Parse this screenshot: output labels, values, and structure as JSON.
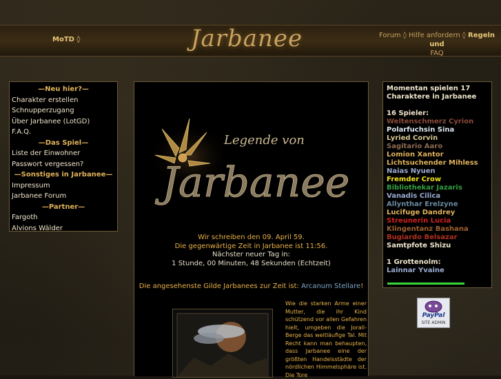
{
  "header": {
    "logo_text": "Jarbanee",
    "motd": "MoTD ◊",
    "topnav": {
      "forum": "Forum ◊",
      "hilfe": "Hilfe anfordern ◊",
      "regeln": "Regeln und",
      "faq": "FAQ"
    }
  },
  "leftnav": [
    {
      "type": "head",
      "label": "—Neu hier?—"
    },
    {
      "type": "link",
      "label": "Charakter erstellen"
    },
    {
      "type": "link",
      "label": "Schnupperzugang"
    },
    {
      "type": "link",
      "label": "Über Jarbanee (LotGD)"
    },
    {
      "type": "link",
      "label": "F.A.Q."
    },
    {
      "type": "head",
      "label": "—Das Spiel—"
    },
    {
      "type": "link",
      "label": "Liste der Einwohner"
    },
    {
      "type": "link",
      "label": "Passwort vergessen?"
    },
    {
      "type": "head",
      "label": "—Sonstiges in Jarbanee—"
    },
    {
      "type": "link",
      "label": "Impressum"
    },
    {
      "type": "link",
      "label": "Jarbanee Forum"
    },
    {
      "type": "head",
      "label": "—Partner—"
    },
    {
      "type": "link",
      "label": "Fargoth"
    },
    {
      "type": "link",
      "label": "Alvions Wälder"
    }
  ],
  "center": {
    "title_small": "Legende von",
    "title_big": "Jarbanee",
    "date_line": "Wir schreiben den 09. April 59.",
    "time_line": "Die gegenwärtige Zeit in Jarbanee ist 11:56.",
    "next_day": "Nächster neuer Tag in:",
    "countdown": "1 Stunde, 00 Minuten, 48 Sekunden (Echtzeit)",
    "guild_prefix": "Die angesehenste Gilde Jarbanees zur Zeit ist: ",
    "guild_name": "Arcanum Stellare",
    "guild_suffix": "!",
    "story": "Wie die starken Arme einer Mutter, die ihr Kind schützend vor allen Gefahren hielt, umgeben die Jorall-Berge das weitläufige Tal. Mit Recht kann man behaupten, dass Jarbanee eine der größten Handelsstädte der nördlichen Himmelsphäre ist. Die Tore"
  },
  "right": {
    "online_header": "Momentan spielen 17 Charaktere in Jarbanee",
    "players_header": "16 Spieler:",
    "players": [
      {
        "name": "Weltenschmerz Cyrion",
        "color": "#8a4a3a"
      },
      {
        "name": "Polarfuchsin Sina",
        "color": "#dfe8f0"
      },
      {
        "name": "Lyried Corvin",
        "color": "#d8c890"
      },
      {
        "name": "Sagitario Aaro",
        "color": "#8a6a50"
      },
      {
        "name": "Lomion Xantor",
        "color": "#e0b25a"
      },
      {
        "name": "Lichtsuchender Mihless",
        "color": "#e0b25a"
      },
      {
        "name": "Naias Nyuen",
        "color": "#9aaad0"
      },
      {
        "name": "Fremder Crow",
        "color": "#f0e020"
      },
      {
        "name": "Bibliothekar Jazaris",
        "color": "#30a040"
      },
      {
        "name": "Vanadis Cilica",
        "color": "#9aaad0"
      },
      {
        "name": "Allynthar Erelzyne",
        "color": "#6a8aa0"
      },
      {
        "name": "Lucifuge Dandrey",
        "color": "#e0b25a"
      },
      {
        "name": "Streunerin Lucia",
        "color": "#d02020"
      },
      {
        "name": "Klingentanz Bashana",
        "color": "#a06030"
      },
      {
        "name": "Bugiardo Belsazar",
        "color": "#b03020"
      },
      {
        "name": "Samtpfote Shizu",
        "color": "#f0e6cc"
      }
    ],
    "grotten_header": "1 Grottenolm:",
    "grotten": [
      {
        "name": "Lainnar Yvaine",
        "color": "#9aaad0"
      }
    ],
    "paypal_label": "PayPal",
    "paypal_sub": "SITE ADMIN"
  }
}
